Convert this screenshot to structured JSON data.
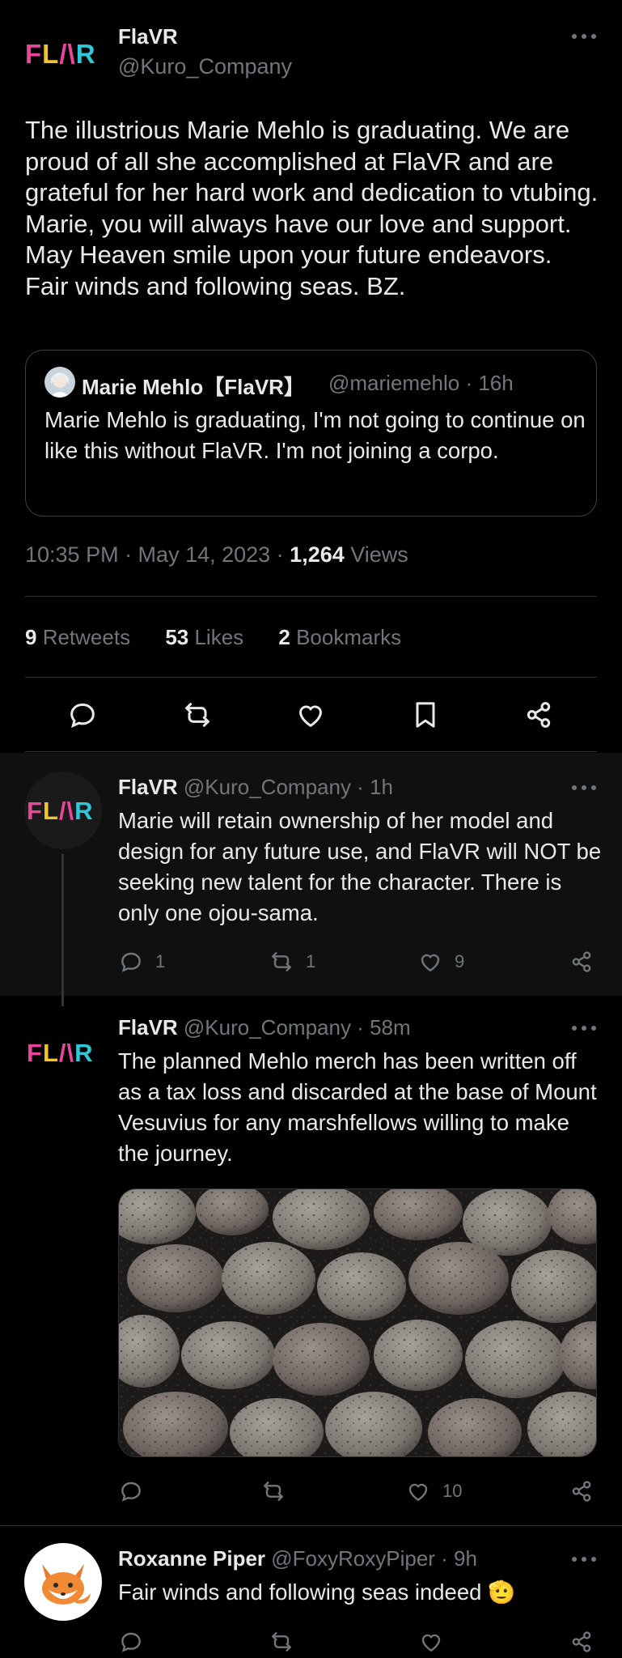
{
  "main_tweet": {
    "logo_text": "FLAVR",
    "name": "FlaVR",
    "handle": "@Kuro_Company",
    "text": "The illustrious Marie Mehlo is graduating. We are proud of all she accomplished at FlaVR and are grateful for her hard work and dedication to vtubing. Marie, you will always have our love and support. May Heaven smile upon your future endeavors. Fair winds and following seas. BZ.",
    "quote": {
      "name": "Marie Mehlo【FlaVR】",
      "handle_time": "@mariemehlo · 16h",
      "text": "Marie Mehlo is graduating, I'm not going to continue on like this without FlaVR. I'm not joining a corpo."
    },
    "timestamp": "10:35 PM · May 14, 2023 · ",
    "views_count": "1,264",
    "views_label": " Views",
    "stats": {
      "retweets_count": "9",
      "retweets_label": " Retweets",
      "likes_count": "53",
      "likes_label": " Likes",
      "bookmarks_count": "2",
      "bookmarks_label": " Bookmarks"
    }
  },
  "replies": [
    {
      "logo_text": "FLAVR",
      "name": "FlaVR",
      "handle_time": " @Kuro_Company · 1h",
      "text": "Marie will retain ownership of her model and design for any future use, and FlaVR will NOT be seeking new talent for the character. There is only one ojou-sama.",
      "replies": "1",
      "retweets": "1",
      "likes": "9"
    },
    {
      "logo_text": "FLAVR",
      "name": "FlaVR",
      "handle_time": " @Kuro_Company · 58m",
      "text": "The planned Mehlo merch has been written off as a tax loss and discarded at the base of Mount Vesuvius for any marshfellows willing to make the journey.",
      "replies": "",
      "retweets": "",
      "likes": "10"
    },
    {
      "name": "Roxanne Piper",
      "handle_time": " @FoxyRoxyPiper · 9h",
      "text": "Fair winds and following seas indeed 🫡"
    }
  ],
  "colors": {
    "background": "#000000",
    "text": "#e7e9ea",
    "muted": "#71767b",
    "logo_pink": "#e8459b",
    "logo_yellow": "#f0c330",
    "logo_cyan": "#2ec8d8"
  }
}
